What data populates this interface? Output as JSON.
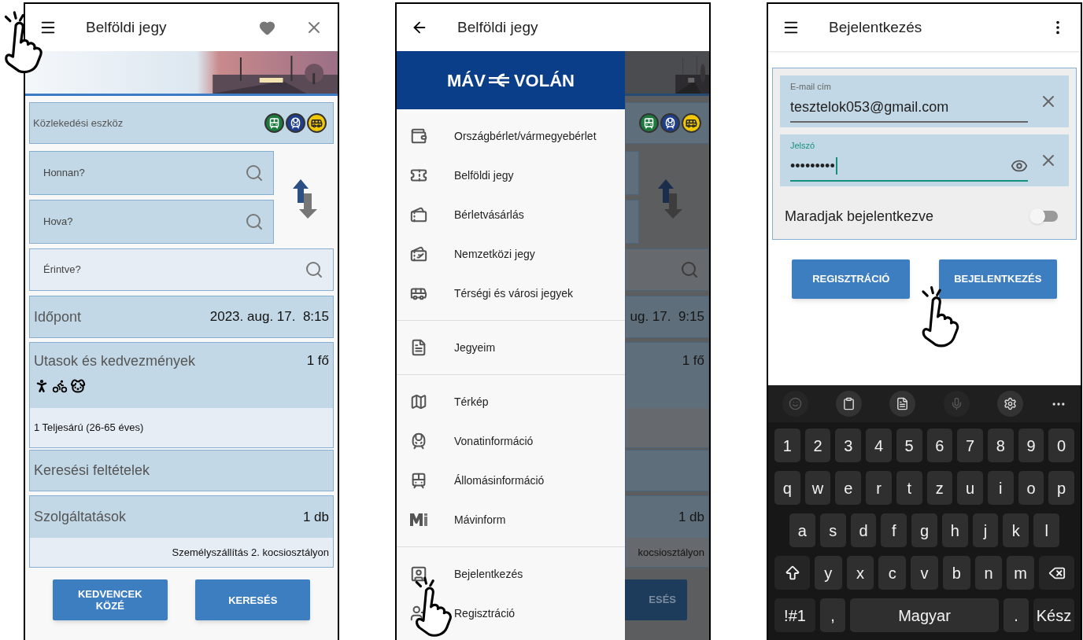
{
  "search_screen": {
    "title": "Belföldi jegy",
    "transport": {
      "label": "Közlekedési eszköz",
      "modes": [
        {
          "kind": "train",
          "color": "#1d7a3e"
        },
        {
          "kind": "intercity",
          "color": "#1f3f8c"
        },
        {
          "kind": "bus",
          "color": "#f0c808"
        }
      ]
    },
    "from": {
      "placeholder": "Honnan?"
    },
    "to": {
      "placeholder": "Hova?"
    },
    "via": {
      "placeholder": "Érintve?"
    },
    "time": {
      "label": "Időpont",
      "value": "2023. aug. 17.  8:15"
    },
    "passengers": {
      "label": "Utasok és kedvezmények",
      "value": "1 fő",
      "detail": "1 Teljesárú (26-65 éves)"
    },
    "criteria": {
      "label": "Keresési feltételek"
    },
    "services": {
      "label": "Szolgáltatások",
      "value": "1 db",
      "detail": "Személyszállítás 2. kocsiosztályon"
    },
    "buttons": [
      "KEDVENCEK KÖZÉ",
      "KERESÉS"
    ]
  },
  "menu_screen": {
    "title": "Belföldi jegy",
    "logo": {
      "left": "MÁV",
      "right": "VOLÁN"
    },
    "groups": [
      [
        {
          "kind": "pass",
          "label": "Országbérlet/vármegyebérlet"
        },
        {
          "kind": "ticket",
          "label": "Belföldi jegy"
        },
        {
          "kind": "tickets",
          "label": "Bérletvásárlás"
        },
        {
          "kind": "international",
          "label": "Nemzetközi jegy"
        },
        {
          "kind": "bus",
          "label": "Térségi és városi jegyek"
        }
      ],
      [
        {
          "kind": "list",
          "label": "Jegyeim"
        }
      ],
      [
        {
          "kind": "map",
          "label": "Térkép"
        },
        {
          "kind": "train",
          "label": "Vonatinformáció"
        },
        {
          "kind": "station",
          "label": "Állomásinformáció"
        },
        {
          "kind": "mavinform",
          "label": "Mávinform"
        }
      ],
      [
        {
          "kind": "login",
          "label": "Bejelentkezés"
        },
        {
          "kind": "register",
          "label": "Regisztráció"
        }
      ]
    ],
    "backdrop": {
      "modes": [
        {
          "kind": "train",
          "color": "#1d7a3e"
        },
        {
          "kind": "intercity",
          "color": "#1f3f8c"
        },
        {
          "kind": "bus",
          "color": "#f0c808"
        }
      ],
      "time": "ug. 17.  9:15",
      "passengers": "1 fő",
      "services": "1 db",
      "detail": "kocsiosztályon",
      "button": "ESÉS"
    }
  },
  "login_screen": {
    "title": "Bejelentkezés",
    "email": {
      "label": "E-mail cím",
      "value": "tesztelok053@gmail.com",
      "focused": false
    },
    "password": {
      "label": "Jelszó",
      "value": "•••••••••",
      "focused": true
    },
    "remember": {
      "label": "Maradjak bejelentkezve",
      "on": false
    },
    "buttons": [
      "REGISZTRÁCIÓ",
      "BEJELENTKEZÉS"
    ],
    "keyboard": {
      "toolbar": [
        {
          "kind": "emoji",
          "disabled": true
        },
        {
          "kind": "clipboard",
          "disabled": false
        },
        {
          "kind": "keypad",
          "disabled": false
        },
        {
          "kind": "mic",
          "disabled": true
        },
        {
          "kind": "settings",
          "disabled": false
        },
        {
          "kind": "more",
          "disabled": false
        }
      ],
      "rows": [
        [
          "1",
          "2",
          "3",
          "4",
          "5",
          "6",
          "7",
          "8",
          "9",
          "0"
        ],
        [
          "q",
          "w",
          "e",
          "r",
          "t",
          "z",
          "u",
          "i",
          "o",
          "p"
        ],
        [
          "a",
          "s",
          "d",
          "f",
          "g",
          "h",
          "j",
          "k",
          "l"
        ]
      ],
      "shift_row": [
        "y",
        "x",
        "c",
        "v",
        "b",
        "n",
        "m"
      ],
      "bottom": [
        {
          "kind": "symbols",
          "label": "!#1"
        },
        {
          "kind": "comma",
          "label": ","
        },
        {
          "kind": "space",
          "label": "Magyar"
        },
        {
          "kind": "period",
          "label": "."
        },
        {
          "kind": "done",
          "label": "Kész"
        }
      ]
    }
  }
}
